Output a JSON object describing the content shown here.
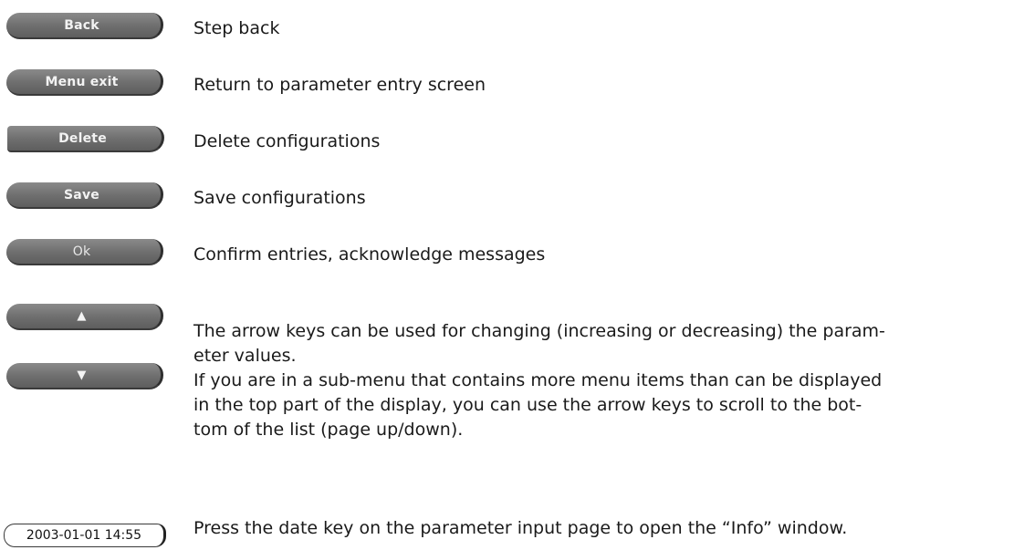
{
  "rows": [
    {
      "key_label": "Back",
      "description": "Step back"
    },
    {
      "key_label": "Menu exit",
      "description": "Return to parameter entry screen"
    },
    {
      "key_label": "Delete",
      "description": "Delete configurations"
    },
    {
      "key_label": "Save",
      "description": "Save configurations"
    },
    {
      "key_label": "Ok",
      "description": "Confirm entries, acknowledge messages"
    }
  ],
  "arrow_keys": {
    "up_icon": "arrow-up-icon",
    "up_glyph": "▲",
    "down_icon": "arrow-down-icon",
    "down_glyph": "▼",
    "description_line1": "The arrow keys can be used for changing (increasing or decreasing) the param-",
    "description_line2": "eter values.",
    "description_line3": "If you are in a sub-menu that contains more menu items than can be displayed",
    "description_line4": "in the top part of the display, you can use the arrow keys to scroll to the bot-",
    "description_line5": "tom of the list (page up/down)."
  },
  "date_key": {
    "label": "2003-01-01 14:55",
    "description": "Press the date key on the parameter input page to open the “Info” window."
  },
  "colors": {
    "key_fill": "#6e6e6e",
    "key_text": "#f2f2f2",
    "body_text": "#1a1a1a"
  }
}
